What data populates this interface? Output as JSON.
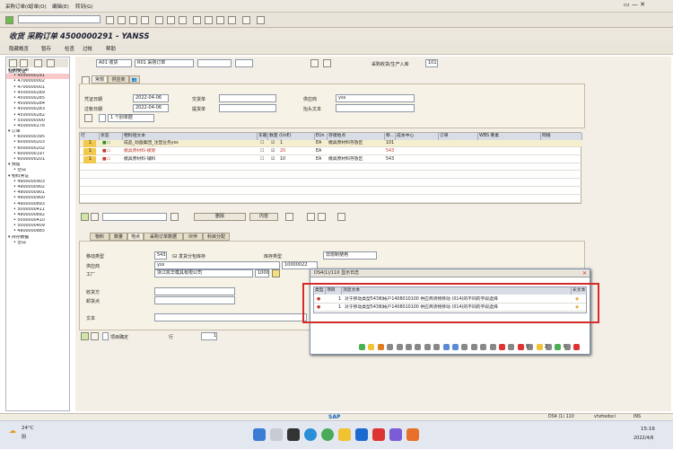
{
  "menu": [
    "采购订单(O)",
    "订单(O)",
    "编辑(E)",
    "转到(G)",
    "环境(N)",
    "系统(Y)",
    "帮助(H)"
  ],
  "title": "收货 采购订单 4500000291 - YANSS",
  "app_toolbar": [
    "隐藏概览",
    "暂存",
    "检查",
    "过帐",
    "帮助"
  ],
  "header": {
    "txn": "A01 收货",
    "ref": "R01 采购订单",
    "mvt_label": "采购收货/生产入库",
    "mvt": "101"
  },
  "tabs_top": [
    "常规",
    "供应商"
  ],
  "general": {
    "doc_date_label": "凭证日期",
    "doc_date": "2022-04-06",
    "post_date_label": "过帐日期",
    "post_date": "2022-04-06",
    "delivery_note_label": "交货单",
    "bill_label": "提货单",
    "vendor_label": "供应商",
    "vendor": "yss",
    "header_text_label": "抬头文本",
    "slip_label": "1 个别单据"
  },
  "items_cols": [
    "行",
    "状态",
    "物料短文本",
    "东箱",
    "数量 (UnE)",
    "EUn",
    "存储地点",
    "移..",
    "成本中心",
    "订单",
    "WBS 要素",
    "网络"
  ],
  "items": [
    {
      "line": "1",
      "text": "成品_动画集团_注塑业务yss",
      "qty": "1",
      "eun": "EA",
      "sloc": "模具原材料存放区",
      "mvt": "101",
      "hl": true
    },
    {
      "line": "1",
      "text": "模具原材料-模架",
      "qty": "20",
      "eun": "EA",
      "sloc": "",
      "mvt": "543",
      "red": true
    },
    {
      "line": "1",
      "text": "模具原材料-辅料",
      "qty": "10",
      "eun": "EA",
      "sloc": "模具原材料存放区",
      "mvt": "543"
    }
  ],
  "mid_buttons": [
    "删除",
    "内容"
  ],
  "tabs_detail": [
    "物料",
    "数量",
    "地点",
    "采购订单数据",
    "伙伴",
    "科目分配"
  ],
  "detail": {
    "mvt_type_label": "移动类型",
    "mvt_type": "543",
    "mvt_desc": "GI 发货分包库存",
    "stock_type_label": "库存类型",
    "stock_type": "非限制使用",
    "vendor_label": "供应商",
    "vendor": "yss",
    "vendor_no": "10000022",
    "plant_label": "工厂",
    "plant": "浙江凯华模具有限公司",
    "plant_no": "1000",
    "recipient_label": "收货方",
    "unload_label": "卸货点",
    "text_label": "文本",
    "item_ok": "项目确定",
    "row_label": "行",
    "row_val": "1"
  },
  "popup": {
    "title": "DS4(1)/110 显示日志",
    "cols": [
      "类型",
      "项目",
      "消息文本",
      "长文本"
    ],
    "rows": [
      {
        "item": "1",
        "msg": "对于移动类型543和帐户1408010100 供应商货物移动 (014)的不同的字段选择"
      },
      {
        "item": "1",
        "msg": "对于移动类型543和帐户1408010100 供应商货物移动 (014)的不同的字段选择"
      }
    ],
    "counts": [
      "0",
      "2",
      "0"
    ]
  },
  "tree": [
    "采购订单",
    "4500000291",
    "4700000002",
    "4700000001",
    "4500000289",
    "4500000285",
    "4500000284",
    "4500000283",
    "4500000282",
    "5500000000",
    "4500000276",
    "订单",
    "6000000395",
    "6000000203",
    "6000000202",
    "6000000197",
    "6000000201",
    "预留",
    "空白",
    "物料凭证",
    "4900000903",
    "4900000902",
    "4900000901",
    "4900000900",
    "4900000893",
    "5000000411",
    "4900000892",
    "5000000410",
    "5000000409",
    "4900000885",
    "持存数据",
    "空白"
  ],
  "status": {
    "sys": "DS4 (1) 110",
    "host": "vhzhedsci",
    "mode": "INS"
  },
  "taskbar": {
    "temp": "24°C",
    "weather": "阴",
    "time": "15:16",
    "date": "2022/4/6"
  },
  "colors": {
    "accent": "#d42b2b",
    "panel": "#f3efe6",
    "header": "#d8dde6"
  }
}
